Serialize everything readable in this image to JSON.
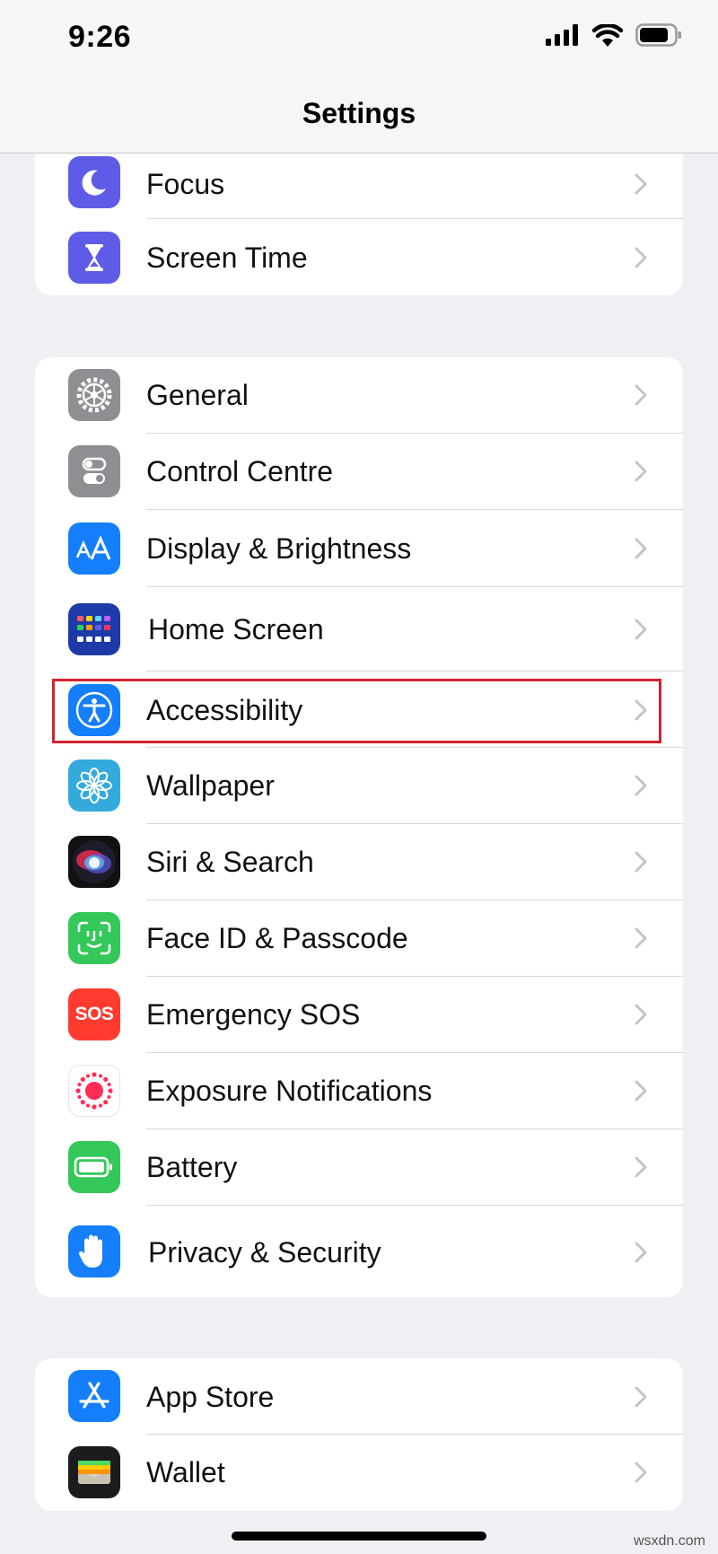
{
  "status": {
    "time": "9:26"
  },
  "nav": {
    "title": "Settings"
  },
  "groups": [
    {
      "items": [
        {
          "label": "Focus",
          "icon": "moon-icon"
        },
        {
          "label": "Screen Time",
          "icon": "hourglass-icon"
        }
      ]
    },
    {
      "items": [
        {
          "label": "General",
          "icon": "gear-icon"
        },
        {
          "label": "Control Centre",
          "icon": "toggles-icon"
        },
        {
          "label": "Display & Brightness",
          "icon": "text-size-icon"
        },
        {
          "label": "Home Screen",
          "icon": "app-grid-icon"
        },
        {
          "label": "Accessibility",
          "icon": "accessibility-icon",
          "highlighted": true
        },
        {
          "label": "Wallpaper",
          "icon": "flower-icon"
        },
        {
          "label": "Siri & Search",
          "icon": "siri-icon"
        },
        {
          "label": "Face ID & Passcode",
          "icon": "face-id-icon"
        },
        {
          "label": "Emergency SOS",
          "icon": "sos-icon",
          "icon_text": "SOS"
        },
        {
          "label": "Exposure Notifications",
          "icon": "exposure-icon"
        },
        {
          "label": "Battery",
          "icon": "battery-icon"
        },
        {
          "label": "Privacy & Security",
          "icon": "hand-icon"
        }
      ]
    },
    {
      "items": [
        {
          "label": "App Store",
          "icon": "app-store-icon"
        },
        {
          "label": "Wallet",
          "icon": "wallet-icon"
        }
      ]
    }
  ],
  "watermark": "wsxdn.com",
  "colors": {
    "background": "#efeff4",
    "highlight": "#d2232f",
    "focus": "#5e5ce6",
    "screen_time": "#5e5ce6",
    "general": "#8e8e93",
    "blue": "#147efb",
    "green": "#34c759",
    "red": "#ff3b30"
  }
}
